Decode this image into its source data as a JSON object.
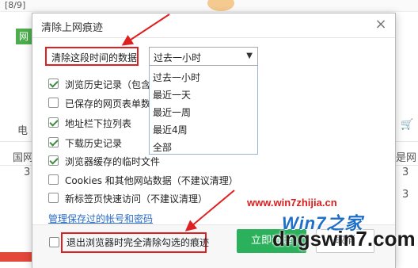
{
  "background": {
    "top_left": "[8/9]",
    "tag": "网",
    "left_texts": [
      "电 ",
      "国网",
      "3"
    ],
    "right_texts": [
      "是网",
      "3",
      "3"
    ],
    "cart_icon": "cart-icon"
  },
  "dialog": {
    "title": "清除上网痕迹",
    "close_icon": "close-icon",
    "range_label": "清除这段时间的数据",
    "select": {
      "value": "过去一小时",
      "options": [
        "过去一小时",
        "最近一天",
        "最近一周",
        "最近4周",
        "全部"
      ]
    },
    "options": [
      {
        "label": "浏览历史记录（包含",
        "checked": true
      },
      {
        "label": "已保存的网页表单数",
        "checked": false
      },
      {
        "label": "地址栏下拉列表",
        "checked": true
      },
      {
        "label": "下载历史记录",
        "checked": true
      },
      {
        "label": "浏览器缓存的临时文件",
        "checked": true
      },
      {
        "label": "Cookies 和其他网站数据（不建议清理）",
        "checked": false
      },
      {
        "label": "新标签页快速访问（不建议清理）",
        "checked": false
      }
    ],
    "manage_link": "管理保存过的帐号和密码",
    "exit_option": {
      "label": "退出浏览器时完全清除勾选的痕迹",
      "checked": false
    },
    "clear_button": "立即清理",
    "cancel_button": "取消"
  },
  "watermark": {
    "url": "www.win7zhijia.cn",
    "logo": "Win7之家",
    "main": "dngswin7.com"
  },
  "colors": {
    "accent_green": "#2bb05b",
    "annotation_red": "#e02020",
    "link_blue": "#2c6cc4"
  }
}
